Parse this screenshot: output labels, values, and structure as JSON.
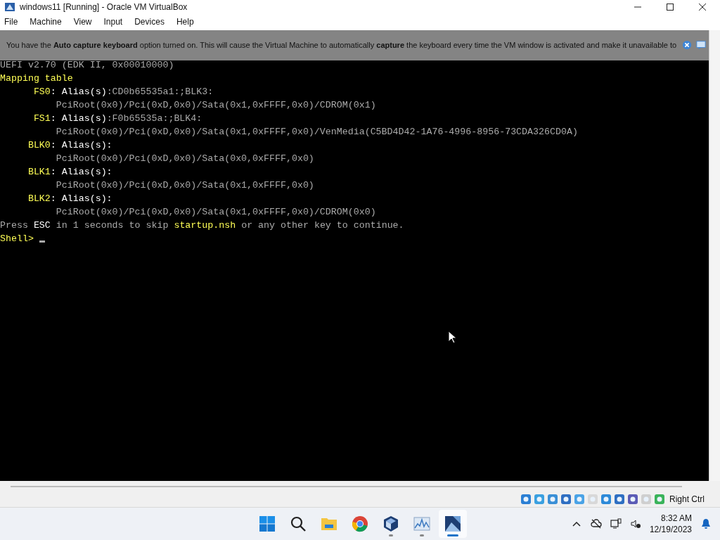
{
  "window": {
    "title": "windows11 [Running] - Oracle VM VirtualBox"
  },
  "menu": [
    "File",
    "Machine",
    "View",
    "Input",
    "Devices",
    "Help"
  ],
  "notification": {
    "text": "You have the **Auto capture keyboard** option turned on. This will cause the Virtual Machine to automatically **capture** the keyboard every time the VM window is activated and make it unavailable to"
  },
  "console": {
    "lines": [
      [
        {
          "kind": "plain",
          "text": "UEFI v2.70 (EDK II, 0x00010000)"
        }
      ],
      [
        {
          "kind": "highlight",
          "text": "Mapping table"
        }
      ],
      [
        {
          "kind": "highlight",
          "text": "      FS0"
        },
        {
          "kind": "bright",
          "text": ": Alias(s)"
        },
        {
          "kind": "plain",
          "text": ":CD0b65535a1:;BLK3:"
        }
      ],
      [
        {
          "kind": "plain",
          "text": "          PciRoot(0x0)/Pci(0xD,0x0)/Sata(0x1,0xFFFF,0x0)/CDROM(0x1)"
        }
      ],
      [
        {
          "kind": "highlight",
          "text": "      FS1"
        },
        {
          "kind": "bright",
          "text": ": Alias(s)"
        },
        {
          "kind": "plain",
          "text": ":F0b65535a:;BLK4:"
        }
      ],
      [
        {
          "kind": "plain",
          "text": "          PciRoot(0x0)/Pci(0xD,0x0)/Sata(0x1,0xFFFF,0x0)/VenMedia(C5BD4D42-1A76-4996-8956-73CDA326CD0A)"
        }
      ],
      [
        {
          "kind": "highlight",
          "text": "     BLK0"
        },
        {
          "kind": "bright",
          "text": ": Alias(s):"
        }
      ],
      [
        {
          "kind": "plain",
          "text": "          PciRoot(0x0)/Pci(0xD,0x0)/Sata(0x0,0xFFFF,0x0)"
        }
      ],
      [
        {
          "kind": "highlight",
          "text": "     BLK1"
        },
        {
          "kind": "bright",
          "text": ": Alias(s):"
        }
      ],
      [
        {
          "kind": "plain",
          "text": "          PciRoot(0x0)/Pci(0xD,0x0)/Sata(0x1,0xFFFF,0x0)"
        }
      ],
      [
        {
          "kind": "highlight",
          "text": "     BLK2"
        },
        {
          "kind": "bright",
          "text": ": Alias(s):"
        }
      ],
      [
        {
          "kind": "plain",
          "text": "          PciRoot(0x0)/Pci(0xD,0x0)/Sata(0x1,0xFFFF,0x0)/CDROM(0x0)"
        }
      ],
      [
        {
          "kind": "plain",
          "text": "Press "
        },
        {
          "kind": "bright",
          "text": "ESC"
        },
        {
          "kind": "plain",
          "text": " in 1 seconds to skip "
        },
        {
          "kind": "highlight",
          "text": "startup.nsh"
        },
        {
          "kind": "plain",
          "text": " or any other key to continue."
        }
      ],
      [
        {
          "kind": "highlight",
          "text": "Shell> "
        }
      ]
    ],
    "cursor": true
  },
  "status_bar": {
    "host_key": "Right Ctrl"
  },
  "taskbar": {
    "apps": [
      {
        "kind": "start",
        "running": false,
        "selected": false
      },
      {
        "kind": "search",
        "running": false,
        "selected": false
      },
      {
        "kind": "folder",
        "running": false,
        "selected": false
      },
      {
        "kind": "browser",
        "running": false,
        "selected": false
      },
      {
        "kind": "cube",
        "running": true,
        "selected": false
      },
      {
        "kind": "chart",
        "running": true,
        "selected": false
      },
      {
        "kind": "tile",
        "running": true,
        "selected": true
      }
    ],
    "time": "8:32 AM",
    "date": "12/19/2023"
  }
}
